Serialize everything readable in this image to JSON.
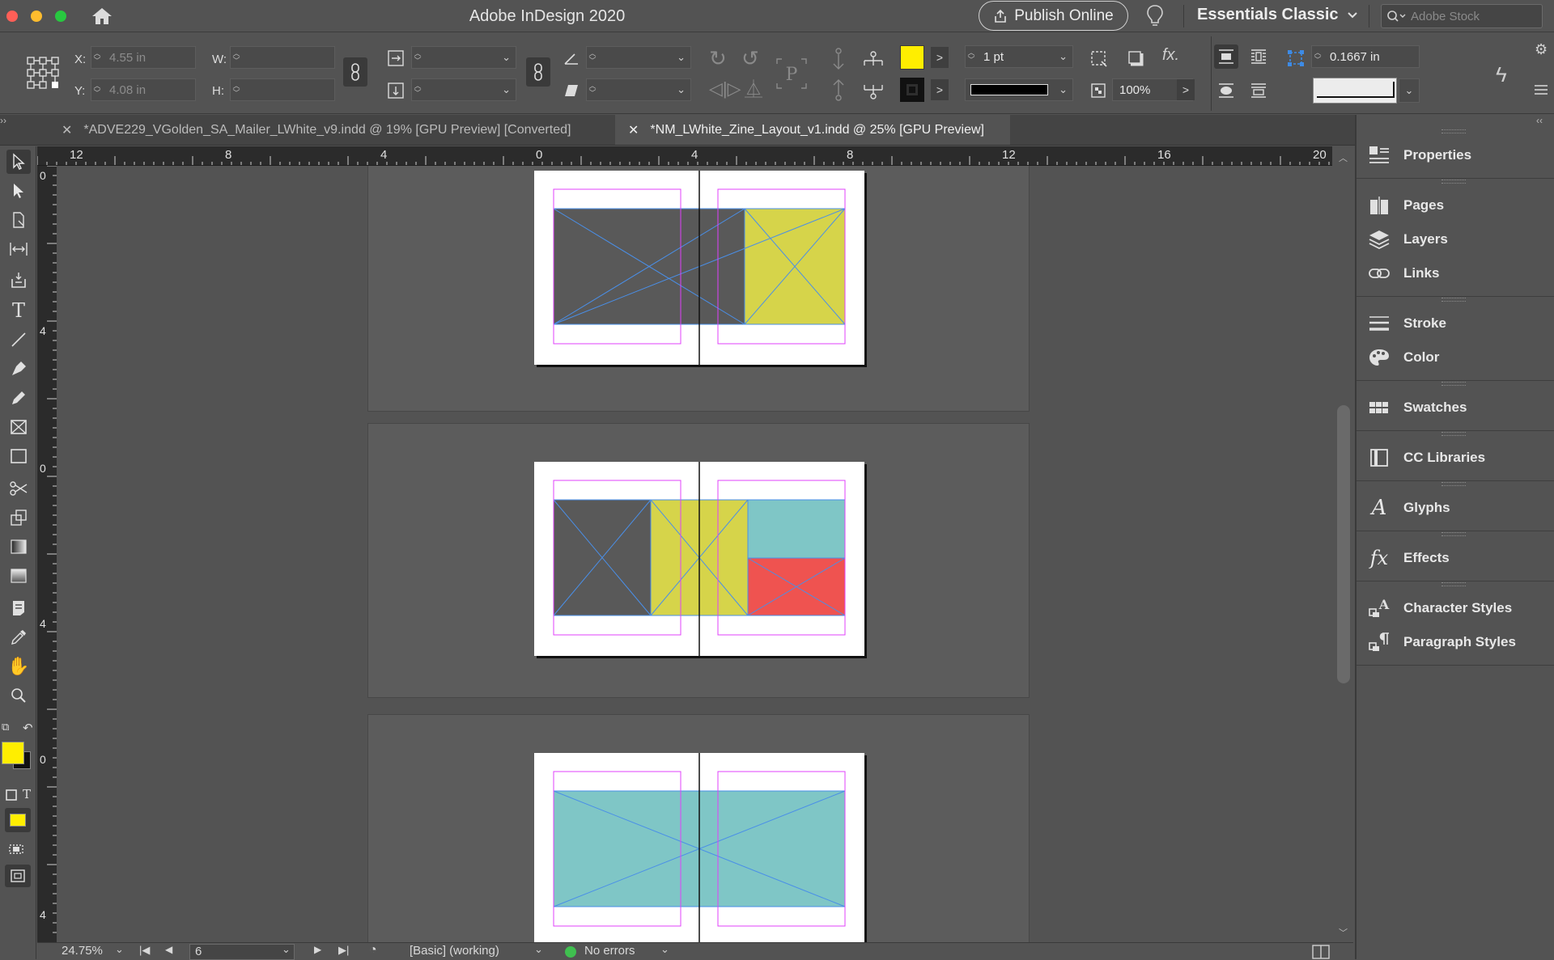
{
  "window": {
    "title": "Adobe InDesign 2020"
  },
  "titlebar": {
    "publish_label": "Publish Online",
    "workspace_label": "Essentials Classic",
    "stock_placeholder": "Adobe Stock"
  },
  "control": {
    "x_label": "X:",
    "x_value": "4.55 in",
    "y_label": "Y:",
    "y_value": "4.08 in",
    "w_label": "W:",
    "h_label": "H:",
    "fill_color": "#ffee00",
    "stroke_weight": "1 pt",
    "opacity": "100%",
    "offset_value": "0.1667 in"
  },
  "tabs": [
    {
      "label": "*ADVE229_VGolden_SA_Mailer_LWhite_v9.indd @ 19% [GPU Preview] [Converted]",
      "active": false
    },
    {
      "label": "*NM_LWhite_Zine_Layout_v1.indd @ 25% [GPU Preview]",
      "active": true
    }
  ],
  "rulers": {
    "h_labels": [
      "12",
      "8",
      "4",
      "0",
      "4",
      "8",
      "12",
      "16",
      "20"
    ],
    "v_labels": [
      "0",
      "4",
      "0",
      "4",
      "0",
      "4"
    ]
  },
  "status": {
    "zoom": "24.75%",
    "page": "6",
    "profile": "[Basic] (working)",
    "preflight": "No errors"
  },
  "panels": [
    {
      "label": "Properties",
      "icon": "properties-icon"
    },
    {
      "label": "Pages",
      "icon": "pages-icon"
    },
    {
      "label": "Layers",
      "icon": "layers-icon"
    },
    {
      "label": "Links",
      "icon": "links-icon"
    },
    {
      "label": "Stroke",
      "icon": "stroke-icon"
    },
    {
      "label": "Color",
      "icon": "color-icon"
    },
    {
      "label": "Swatches",
      "icon": "swatches-icon"
    },
    {
      "label": "CC Libraries",
      "icon": "cc-libraries-icon"
    },
    {
      "label": "Glyphs",
      "icon": "glyphs-icon"
    },
    {
      "label": "Effects",
      "icon": "effects-icon"
    },
    {
      "label": "Character Styles",
      "icon": "character-styles-icon"
    },
    {
      "label": "Paragraph Styles",
      "icon": "paragraph-styles-icon"
    }
  ],
  "colors": {
    "frame_gray": "#595959",
    "frame_yellow": "#d6d44a",
    "frame_teal": "#7fc6c6",
    "frame_red": "#ef5350",
    "margin_guide": "#e040fb",
    "frame_cross": "#4a8fe8"
  }
}
